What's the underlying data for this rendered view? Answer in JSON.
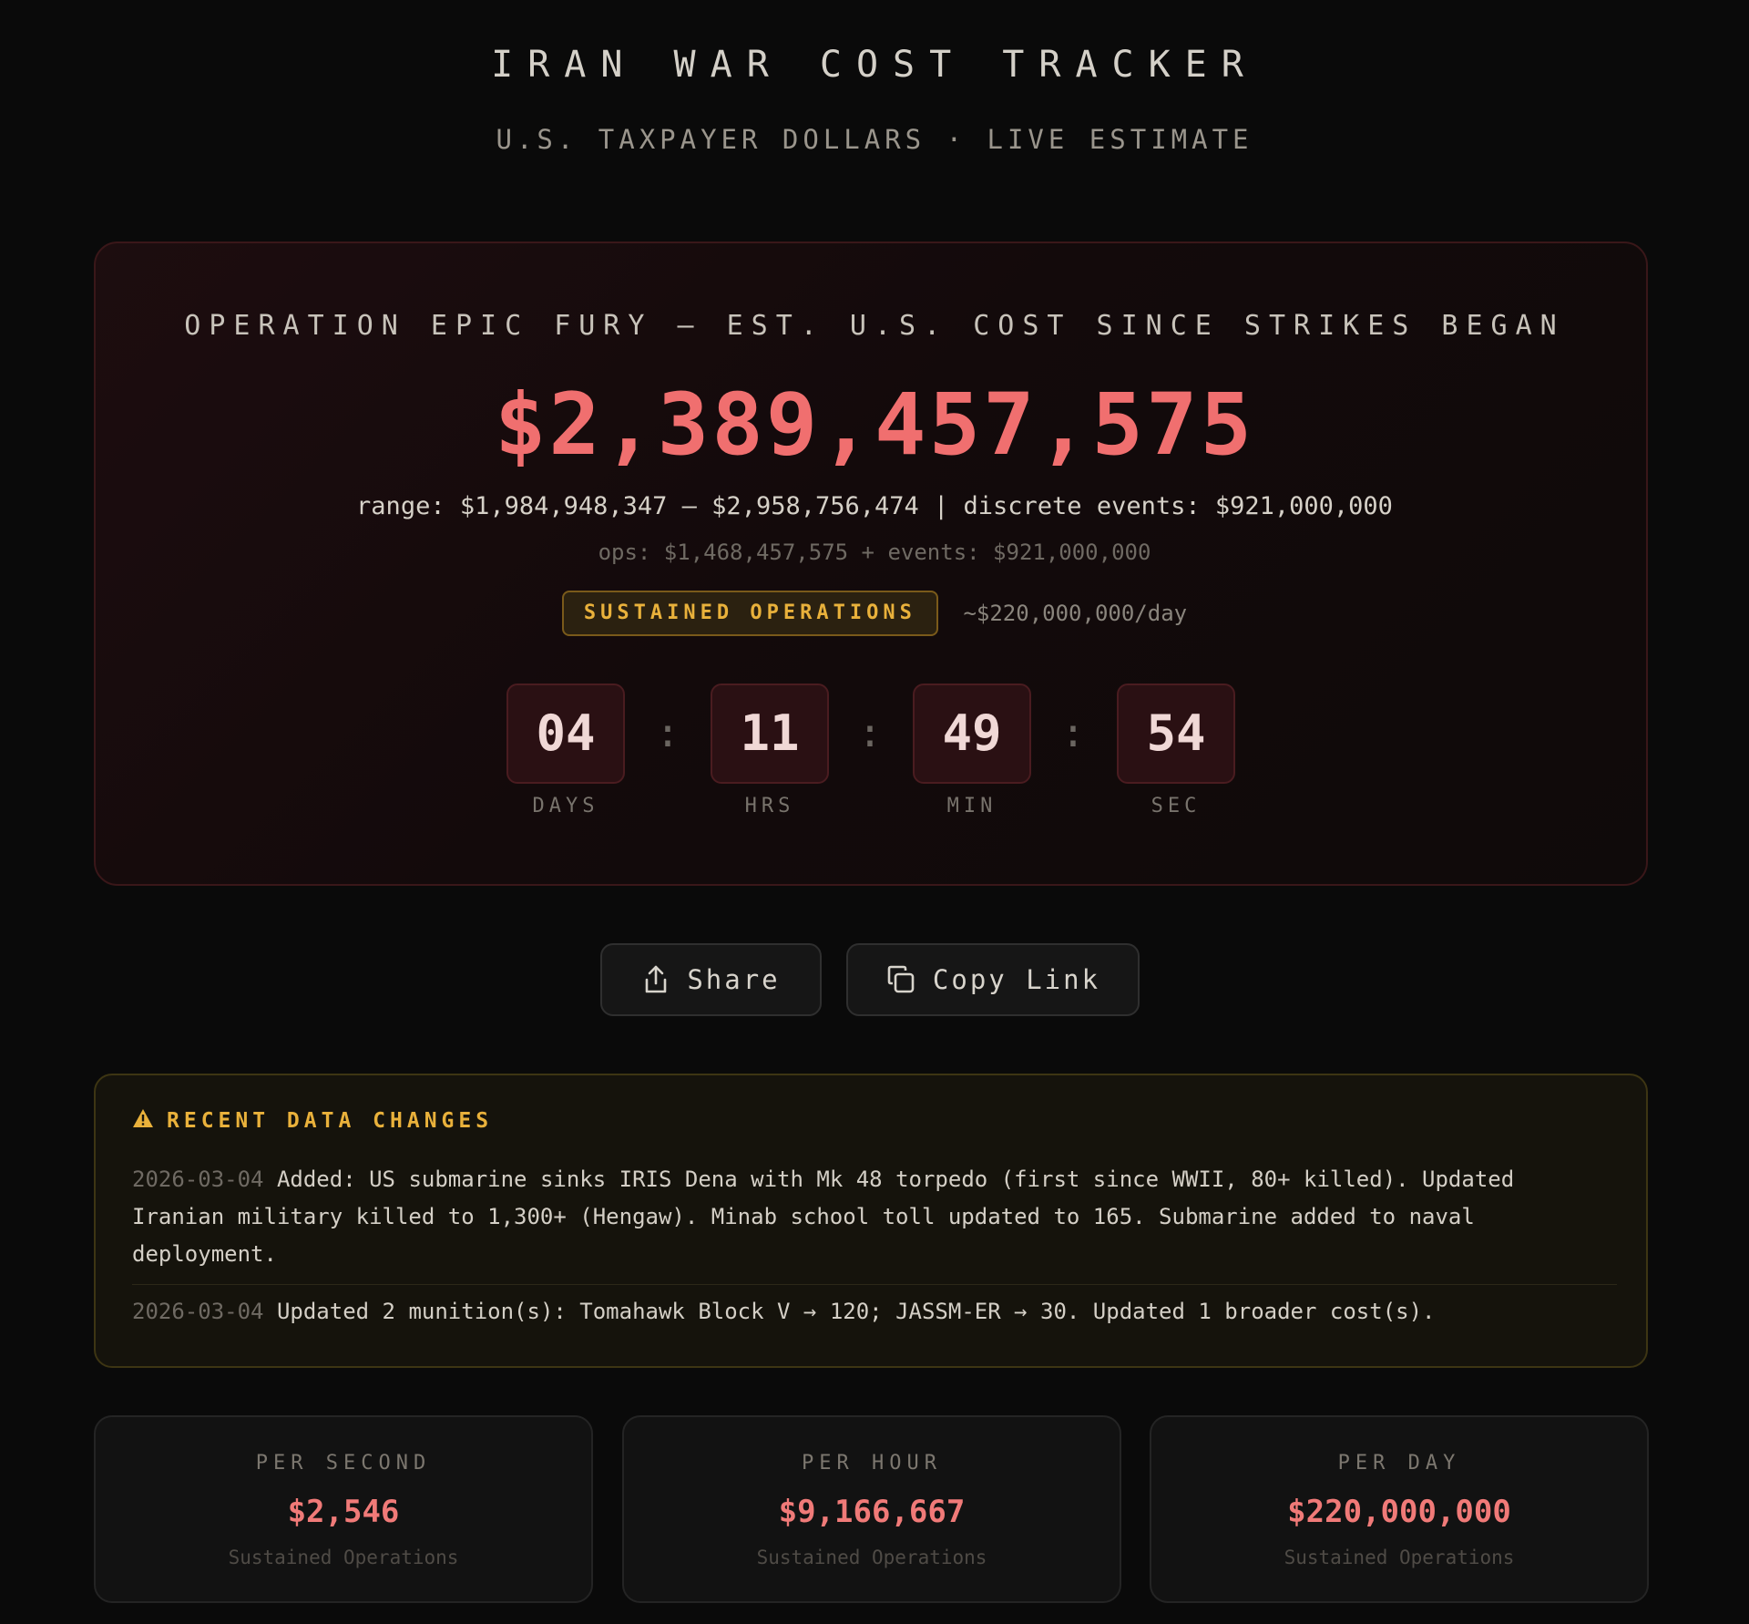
{
  "header": {
    "title": "IRAN WAR COST TRACKER",
    "subtitle": "U.S. TAXPAYER DOLLARS · LIVE ESTIMATE"
  },
  "main": {
    "heading": "OPERATION EPIC FURY — EST. U.S. COST SINCE STRIKES BEGAN",
    "total": "$2,389,457,575",
    "range_line": "range: $1,984,948,347 – $2,958,756,474 | discrete events: $921,000,000",
    "ops_line": "ops: $1,468,457,575 + events: $921,000,000",
    "status_badge": "SUSTAINED OPERATIONS",
    "status_rate": "~$220,000,000/day",
    "status_color": "#e9b13b",
    "accent_color": "#f06f6f",
    "timer": {
      "days": "04",
      "days_label": "DAYS",
      "hours": "11",
      "hours_label": "HRS",
      "minutes": "49",
      "minutes_label": "MIN",
      "seconds": "54",
      "seconds_label": "SEC",
      "separator": ":"
    }
  },
  "actions": {
    "share_label": "Share",
    "share_icon": "share-icon",
    "copy_label": "Copy Link",
    "copy_icon": "copy-icon"
  },
  "changes": {
    "title": "RECENT DATA CHANGES",
    "icon": "warning-icon",
    "items": [
      {
        "date": "2026-03-04",
        "text": "Added: US submarine sinks IRIS Dena with Mk 48 torpedo (first since WWII, 80+ killed). Updated Iranian military killed to 1,300+ (Hengaw). Minab school toll updated to 165. Submarine added to naval deployment."
      },
      {
        "date": "2026-03-04",
        "text": "Updated 2 munition(s): Tomahawk Block V → 120; JASSM-ER → 30. Updated 1 broader cost(s)."
      }
    ]
  },
  "stats": [
    {
      "label": "PER SECOND",
      "value": "$2,546",
      "sub": "Sustained Operations"
    },
    {
      "label": "PER HOUR",
      "value": "$9,166,667",
      "sub": "Sustained Operations"
    },
    {
      "label": "PER DAY",
      "value": "$220,000,000",
      "sub": "Sustained Operations"
    }
  ]
}
